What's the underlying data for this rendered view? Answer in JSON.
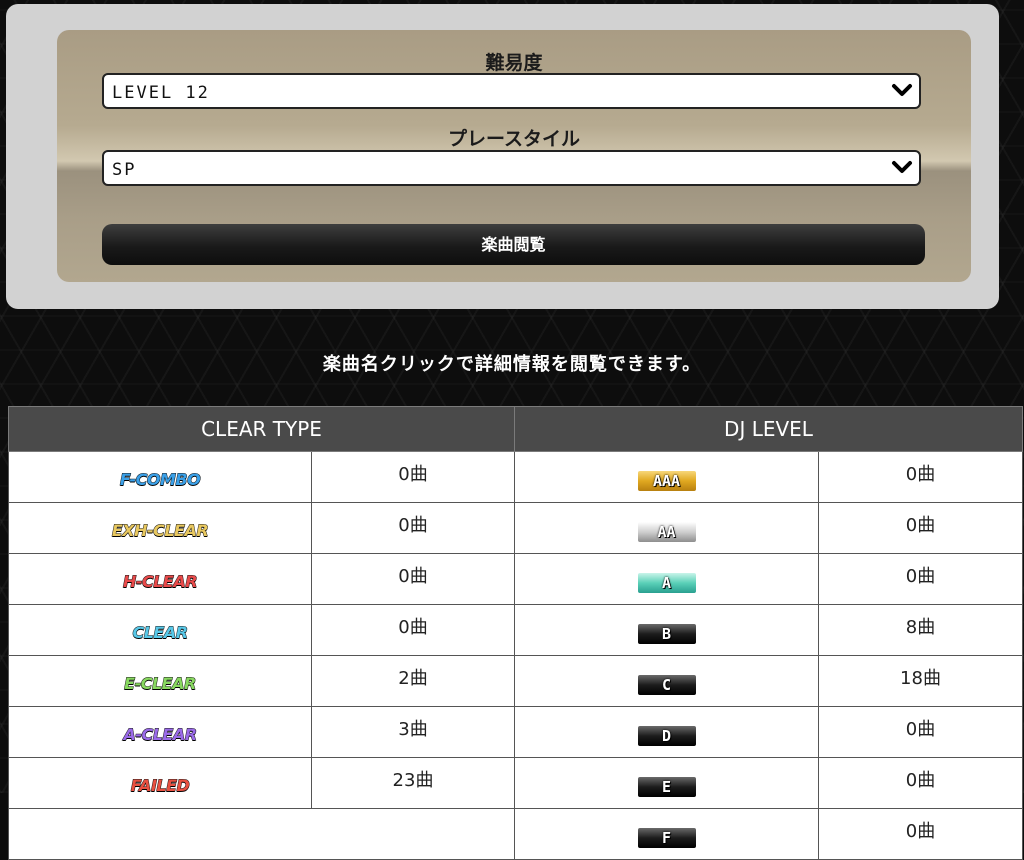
{
  "form": {
    "difficulty_label": "難易度",
    "difficulty_value": "LEVEL 12",
    "play_style_label": "プレースタイル",
    "play_style_value": "SP",
    "view_button": "楽曲閲覧"
  },
  "info_text": "楽曲名クリックで詳細情報を閲覧できます。",
  "table": {
    "clear_type_header": "CLEAR TYPE",
    "dj_level_header": "DJ LEVEL",
    "clear_types": [
      {
        "label": "F-COMBO",
        "count": "0曲",
        "color": "#3aa0e8"
      },
      {
        "label": "EXH-CLEAR",
        "count": "0曲",
        "color": "#e8c860"
      },
      {
        "label": "H-CLEAR",
        "count": "0曲",
        "color": "#e84a4a"
      },
      {
        "label": "CLEAR",
        "count": "0曲",
        "color": "#58c8e8"
      },
      {
        "label": "E-CLEAR",
        "count": "2曲",
        "color": "#88d860"
      },
      {
        "label": "A-CLEAR",
        "count": "3曲",
        "color": "#9a6ae8"
      },
      {
        "label": "FAILED",
        "count": "23曲",
        "color": "#e85040"
      }
    ],
    "dj_levels": [
      {
        "label": "AAA",
        "count": "0曲",
        "style": "gold"
      },
      {
        "label": "AA",
        "count": "0曲",
        "style": "silver"
      },
      {
        "label": "A",
        "count": "0曲",
        "style": "teal"
      },
      {
        "label": "B",
        "count": "8曲",
        "style": "dark"
      },
      {
        "label": "C",
        "count": "18曲",
        "style": "dark"
      },
      {
        "label": "D",
        "count": "0曲",
        "style": "dark"
      },
      {
        "label": "E",
        "count": "0曲",
        "style": "dark"
      },
      {
        "label": "F",
        "count": "0曲",
        "style": "dark"
      }
    ]
  }
}
